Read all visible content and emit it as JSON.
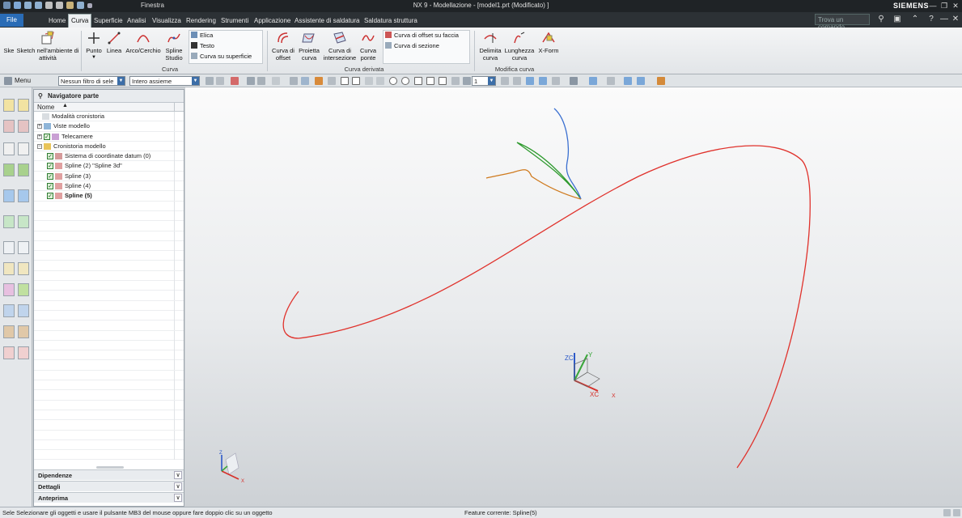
{
  "titlebar": {
    "finestra": "Finestra",
    "window_title": "NX 9 - Modellazione - [model1.prt (Modificato) ]",
    "brand": "SIEMENS"
  },
  "tabs": {
    "file": "File",
    "items": [
      "Home",
      "Curva",
      "Superficie",
      "Analisi",
      "Visualizza",
      "Rendering",
      "Strumenti",
      "Applicazione",
      "Assistente di saldatura",
      "Saldatura struttura"
    ],
    "active": "Curva",
    "search_placeholder": "Trova un comando"
  },
  "ribbon": {
    "sketch_short": "Ske",
    "sketch_env": "Sketch nell'ambiente di attività",
    "punto": "Punto",
    "linea": "Linea",
    "arco": "Arco/Cerchio",
    "spline": "Spline Studio",
    "elica": "Elica",
    "testo": "Testo",
    "curva_su_superficie": "Curva su superficie",
    "group_curva": "Curva",
    "curva_offset": "Curva di offset",
    "proietta_curva": "Proietta curva",
    "curva_intersezione": "Curva di intersezione",
    "curva_ponte": "Curva ponte",
    "curva_offset_faccia": "Curva di offset su faccia",
    "curva_sezione": "Curva di sezione",
    "group_curva_derivata": "Curva derivata",
    "delimita_curva": "Delimita curva",
    "lunghezza_curva": "Lunghezza curva",
    "xform": "X-Form",
    "group_modifica_curva": "Modifica curva"
  },
  "toolbar2": {
    "menu": "Menu",
    "filter": "Nessun filtro di sele",
    "scope": "Intero assieme",
    "layer": "1"
  },
  "navigator": {
    "title": "Navigatore parte",
    "column": "Nome",
    "rows": [
      {
        "label": "Modalità cronistoria",
        "indent": 1,
        "check": false,
        "expander": false,
        "bold": false
      },
      {
        "label": "Viste modello",
        "indent": 0,
        "check": false,
        "expander": true,
        "bold": false
      },
      {
        "label": "Telecamere",
        "indent": 0,
        "check": true,
        "expander": true,
        "bold": false
      },
      {
        "label": "Cronistoria modello",
        "indent": 0,
        "check": false,
        "expander": true,
        "expanded": true,
        "bold": false
      },
      {
        "label": "Sistema di coordinate datum (0)",
        "indent": 2,
        "check": true,
        "expander": false,
        "bold": false
      },
      {
        "label": "Spline (2) \"Spline 3d\"",
        "indent": 2,
        "check": true,
        "expander": false,
        "bold": false
      },
      {
        "label": "Spline (3)",
        "indent": 2,
        "check": true,
        "expander": false,
        "bold": false
      },
      {
        "label": "Spline (4)",
        "indent": 2,
        "check": true,
        "expander": false,
        "bold": false
      },
      {
        "label": "Spline (5)",
        "indent": 2,
        "check": true,
        "expander": false,
        "bold": true
      }
    ],
    "panels": [
      "Dipendenze",
      "Dettagli",
      "Anteprima"
    ]
  },
  "viewport": {
    "csys_labels": {
      "zc": "ZC",
      "y": "Y",
      "xc": "XC",
      "x": "X",
      "z": "Z"
    },
    "colors": {
      "red_spline": "#e0322c",
      "green_spline": "#2e9a2e",
      "blue_spline": "#3a6fd0",
      "orange_spline": "#cf7a1e"
    }
  },
  "status": {
    "left": "Sele Selezionare gli oggetti e usare il pulsante MB3 del mouse oppure fare doppio clic su un oggetto",
    "right": "Feature corrente: Spline(5)"
  }
}
